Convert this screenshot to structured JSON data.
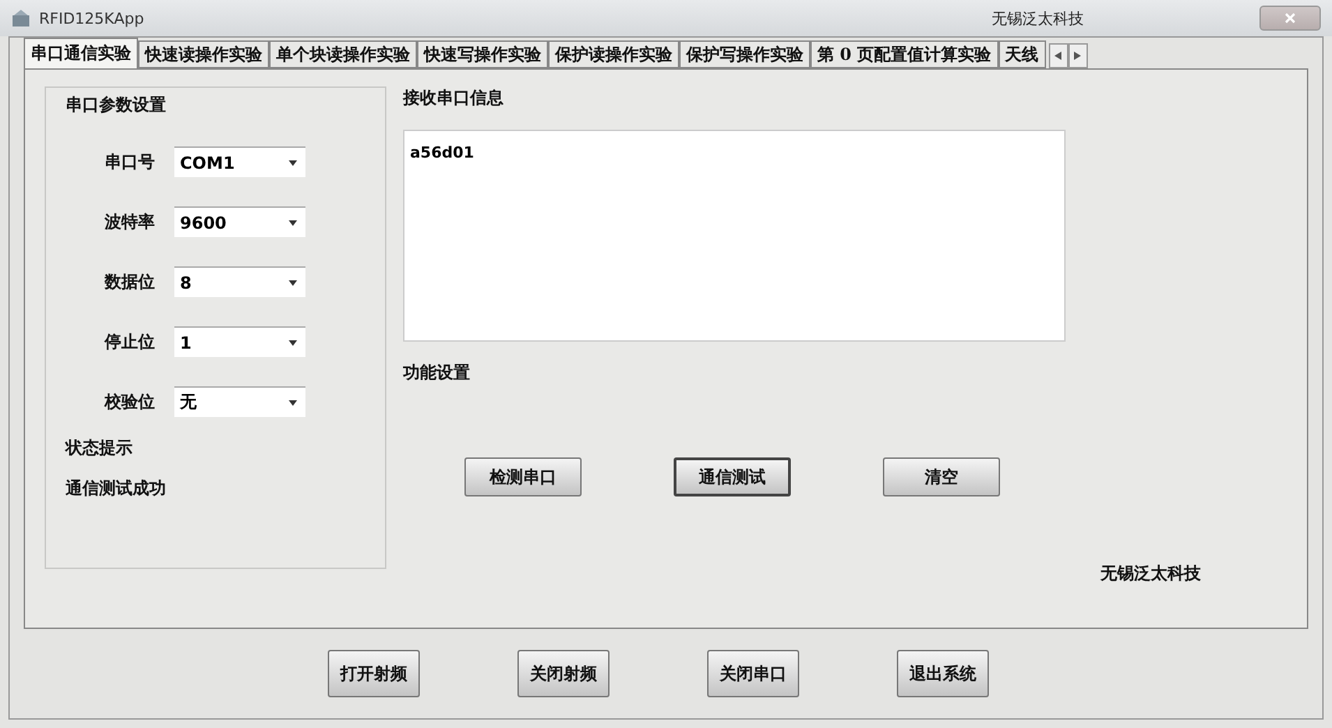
{
  "window": {
    "title": "RFID125KApp",
    "caption": "无锡泛太科技"
  },
  "tabs": [
    {
      "label": "串口通信实验",
      "selected": true
    },
    {
      "label": "快速读操作实验",
      "selected": false
    },
    {
      "label": "单个块读操作实验",
      "selected": false
    },
    {
      "label": "快速写操作实验",
      "selected": false
    },
    {
      "label": "保护读操作实验",
      "selected": false
    },
    {
      "label": "保护写操作实验",
      "selected": false
    },
    {
      "label": "第 0 页配置值计算实验",
      "selected": false
    },
    {
      "label": "天线",
      "selected": false
    }
  ],
  "serial_settings": {
    "title": "串口参数设置",
    "fields": [
      {
        "label": "串口号",
        "value": "COM1"
      },
      {
        "label": "波特率",
        "value": "9600"
      },
      {
        "label": "数据位",
        "value": "8"
      },
      {
        "label": "停止位",
        "value": "1"
      },
      {
        "label": "校验位",
        "value": "无"
      }
    ],
    "status_title": "状态提示",
    "status": "通信测试成功"
  },
  "receive": {
    "title": "接收串口信息",
    "text": "a56d01"
  },
  "functions": {
    "title": "功能设置",
    "buttons": [
      {
        "label": "检测串口",
        "default": false
      },
      {
        "label": "通信测试",
        "default": true
      },
      {
        "label": "清空",
        "default": false
      }
    ]
  },
  "company": "无锡泛太科技",
  "bottom_buttons": [
    "打开射频",
    "关闭射频",
    "关闭串口",
    "退出系统"
  ]
}
